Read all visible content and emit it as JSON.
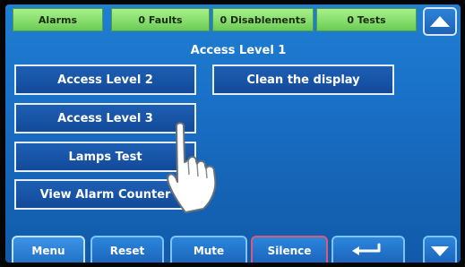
{
  "status_bar": {
    "alarms": "Alarms",
    "faults": "0 Faults",
    "disablements": "0 Disablements",
    "tests": "0 Tests",
    "scroll_up_icon": "triangle-up-icon"
  },
  "title": "Access Level 1",
  "menu": {
    "access_level_2": "Access Level 2",
    "clean_display": "Clean the display",
    "access_level_3": "Access Level 3",
    "lamps_test": "Lamps Test",
    "view_alarm_counter": "View Alarm Counter"
  },
  "bottom_bar": {
    "menu": "Menu",
    "reset": "Reset",
    "mute": "Mute",
    "silence": "Silence",
    "return_icon": "return-arrow-icon",
    "scroll_down_icon": "triangle-down-icon"
  }
}
